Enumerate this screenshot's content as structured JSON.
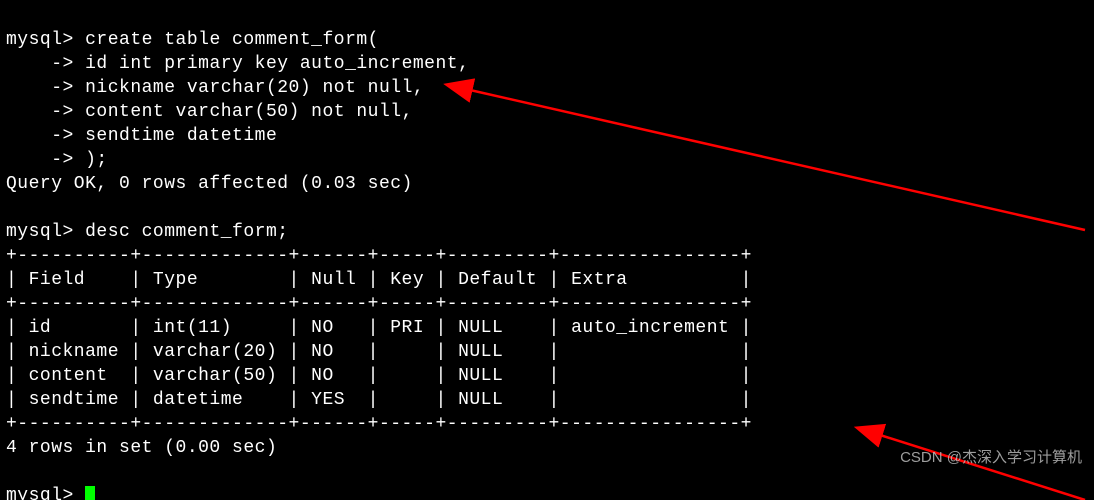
{
  "prompt": "mysql>",
  "cont": "    ->",
  "create_table": {
    "cmd": "create table comment_form(",
    "lines": [
      "id int primary key auto_increment,",
      "nickname varchar(20) not null,",
      "content varchar(50) not null,",
      "sendtime datetime",
      ");"
    ],
    "result": "Query OK, 0 rows affected (0.03 sec)"
  },
  "desc_cmd": "desc comment_form;",
  "table": {
    "border_top": "+----------+-------------+------+-----+---------+----------------+",
    "header_row": "| Field    | Type        | Null | Key | Default | Extra          |",
    "border_mid": "+----------+-------------+------+-----+---------+----------------+",
    "rows": [
      "| id       | int(11)     | NO   | PRI | NULL    | auto_increment |",
      "| nickname | varchar(20) | NO   |     | NULL    |                |",
      "| content  | varchar(50) | NO   |     | NULL    |                |",
      "| sendtime | datetime    | YES  |     | NULL    |                |"
    ],
    "border_bot": "+----------+-------------+------+-----+---------+----------------+",
    "summary": "4 rows in set (0.00 sec)"
  },
  "chart_data": {
    "type": "table",
    "title": "desc comment_form",
    "columns": [
      "Field",
      "Type",
      "Null",
      "Key",
      "Default",
      "Extra"
    ],
    "rows": [
      [
        "id",
        "int(11)",
        "NO",
        "PRI",
        "NULL",
        "auto_increment"
      ],
      [
        "nickname",
        "varchar(20)",
        "NO",
        "",
        "NULL",
        ""
      ],
      [
        "content",
        "varchar(50)",
        "NO",
        "",
        "NULL",
        ""
      ],
      [
        "sendtime",
        "datetime",
        "YES",
        "",
        "NULL",
        ""
      ]
    ]
  },
  "watermark": "CSDN @杰深入学习计算机"
}
